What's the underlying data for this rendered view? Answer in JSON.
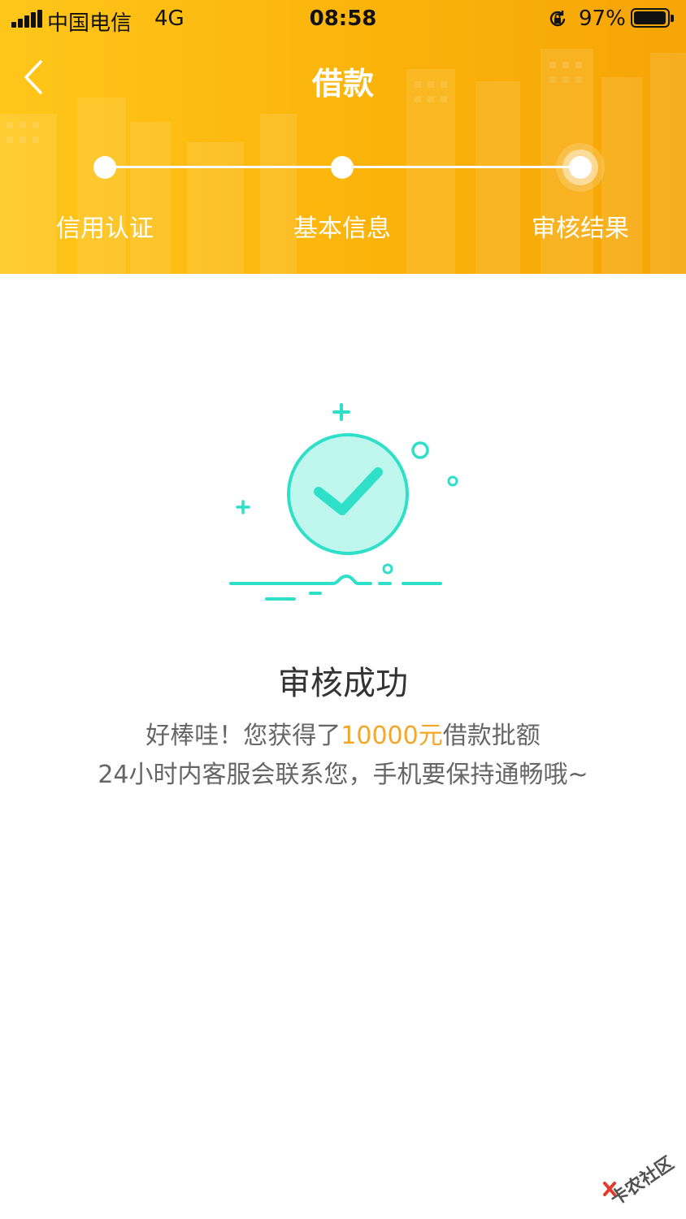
{
  "status_bar": {
    "carrier": "中国电信",
    "network": "4G",
    "time": "08:58",
    "battery_percent": "97%",
    "battery_level": 0.97
  },
  "nav": {
    "title": "借款",
    "back_icon": "chevron-left-icon"
  },
  "steps": [
    {
      "label": "信用认证",
      "state": "done"
    },
    {
      "label": "基本信息",
      "state": "done"
    },
    {
      "label": "审核结果",
      "state": "current"
    }
  ],
  "result": {
    "icon": "success-check-icon",
    "title": "审核成功",
    "line1_prefix": "好棒哇！您获得了",
    "amount": "10000元",
    "line1_suffix": "借款批额",
    "line2": "24小时内客服会联系您，手机要保持通畅哦~"
  },
  "watermark": {
    "text": "卡农社区"
  },
  "colors": {
    "header_start": "#ffc61a",
    "header_end": "#f6a507",
    "accent_teal": "#2ee0c8",
    "amount": "#f5a623",
    "title_text": "#333333",
    "body_text": "#666666"
  }
}
